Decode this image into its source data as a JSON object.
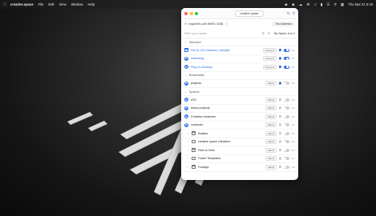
{
  "menubar": {
    "app_name": "creative.space",
    "menus": [
      "File",
      "Edit",
      "View",
      "Window",
      "Help"
    ],
    "clock": "Thu Mar 31  5:19"
  },
  "window": {
    "title": "creative.space",
    "vault_name": "rogue39-LAN WINS 1168",
    "user_label": "Tim Andersen",
    "search_placeholder": "Filter your vaults",
    "sort_label": "By Name: A to Z"
  },
  "sections": {
    "mounted": "Mounted",
    "bookmarks": "Bookmarks",
    "spaces": "Spaces"
  },
  "mounted_rows": [
    {
      "label": "DM-M_001-Dateline_Lifestyle",
      "tag": "Unmount",
      "icon": "folder-icon",
      "blue": true,
      "bookmarked": true,
      "toggle": true
    },
    {
      "label": "marketing",
      "tag": "Unmount",
      "icon": "space-icon",
      "blue": true,
      "bookmarked": true,
      "toggle": true
    },
    {
      "label": "Play-on-Desktop",
      "tag": "Unmount",
      "icon": "space-icon",
      "blue": true,
      "bookmarked": true,
      "toggle": true
    }
  ],
  "bookmark_rows": [
    {
      "label": "projects",
      "tag": "Mount",
      "icon": "space-icon",
      "blue": false,
      "bookmarked": true,
      "toggle": false
    }
  ],
  "space_rows": [
    {
      "label": "ATS",
      "tag": "Mount",
      "icon": "space-icon",
      "bookmarked": false,
      "toggle": false,
      "level": 0
    },
    {
      "label": "brand-projects",
      "tag": "Mount",
      "icon": "space-icon",
      "bookmarked": false,
      "toggle": false,
      "level": 0
    },
    {
      "label": "Christine Andersen",
      "tag": "Mount",
      "icon": "space-icon",
      "bookmarked": false,
      "toggle": false,
      "level": 0
    },
    {
      "label": "customer",
      "tag": "Mount",
      "icon": "space-icon",
      "bookmarked": false,
      "toggle": false,
      "level": 0
    },
    {
      "label": "Avatars",
      "tag": "Mount",
      "icon": "folder-icon",
      "bookmarked": false,
      "toggle": false,
      "level": 1
    },
    {
      "label": "creative space Literature",
      "tag": "Mount",
      "icon": "folder-icon",
      "bookmarked": false,
      "toggle": false,
      "level": 1
    },
    {
      "label": "Files to View",
      "tag": "Mount",
      "icon": "folder-icon",
      "bookmarked": false,
      "toggle": false,
      "level": 1
    },
    {
      "label": "Folder Templates",
      "tag": "Mount",
      "icon": "folder-icon",
      "bookmarked": false,
      "toggle": false,
      "level": 1
    },
    {
      "label": "Footage",
      "tag": "Mount",
      "icon": "folder-icon",
      "bookmarked": false,
      "toggle": false,
      "level": 1
    }
  ],
  "colors": {
    "accent": "#2f6fed",
    "toggle_off": "#cfcfcf"
  }
}
